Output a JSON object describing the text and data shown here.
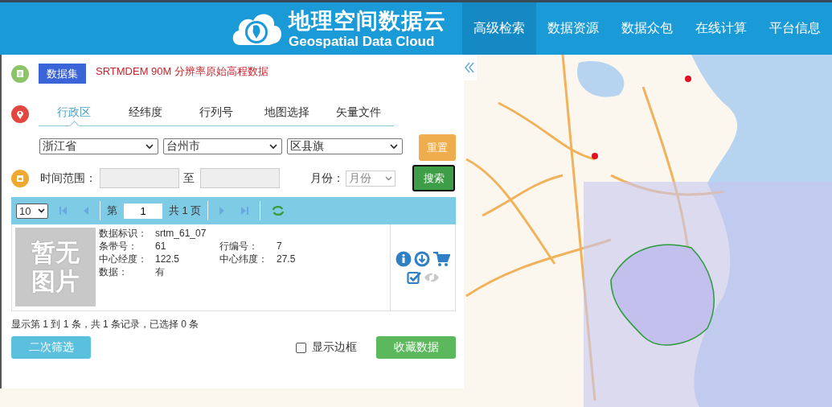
{
  "header": {
    "logo_title": "地理空间数据云",
    "logo_subtitle": "Geospatial Data Cloud",
    "nav": [
      {
        "label": "高级检索",
        "selected": true
      },
      {
        "label": "数据资源",
        "selected": false
      },
      {
        "label": "数据众包",
        "selected": false
      },
      {
        "label": "在线计算",
        "selected": false
      },
      {
        "label": "平台信息",
        "selected": false
      }
    ]
  },
  "dataset": {
    "tag": "数据集",
    "name": "SRTMDEM 90M 分辨率原始高程数据"
  },
  "region_tabs": [
    {
      "label": "行政区",
      "selected": true
    },
    {
      "label": "经纬度",
      "selected": false
    },
    {
      "label": "行列号",
      "selected": false
    },
    {
      "label": "地图选择",
      "selected": false
    },
    {
      "label": "矢量文件",
      "selected": false
    }
  ],
  "region_selects": [
    "浙江省",
    "台州市",
    "区县旗"
  ],
  "buttons": {
    "reset": "重置",
    "search": "搜索"
  },
  "time_range": {
    "label": "时间范围：",
    "separator": "至",
    "month_label": "月份：",
    "month_select": "月份"
  },
  "pager": {
    "page_size": "10",
    "page_prefix": "第",
    "page": "1",
    "page_suffix": "共 1 页"
  },
  "results": [
    {
      "thumbnail_lines": [
        "暂无",
        "图片"
      ],
      "rows": [
        [
          {
            "label": "数据标识：",
            "value": "srtm_61_07"
          }
        ],
        [
          {
            "label": "条带号：",
            "value": "61"
          },
          {
            "label": "行编号：",
            "value": "7"
          }
        ],
        [
          {
            "label": "中心经度：",
            "value": "122.5"
          },
          {
            "label": "中心纬度：",
            "value": "27.5"
          }
        ],
        [
          {
            "label": "数据：",
            "value": "有"
          }
        ]
      ]
    }
  ],
  "summary": "显示第 1 到 1 条，共 1 条记录，已选择 0 条",
  "footer": {
    "filter_button": "二次筛选",
    "show_border": {
      "label": "显示边框",
      "checked": false
    },
    "collect_button": "收藏数据"
  }
}
